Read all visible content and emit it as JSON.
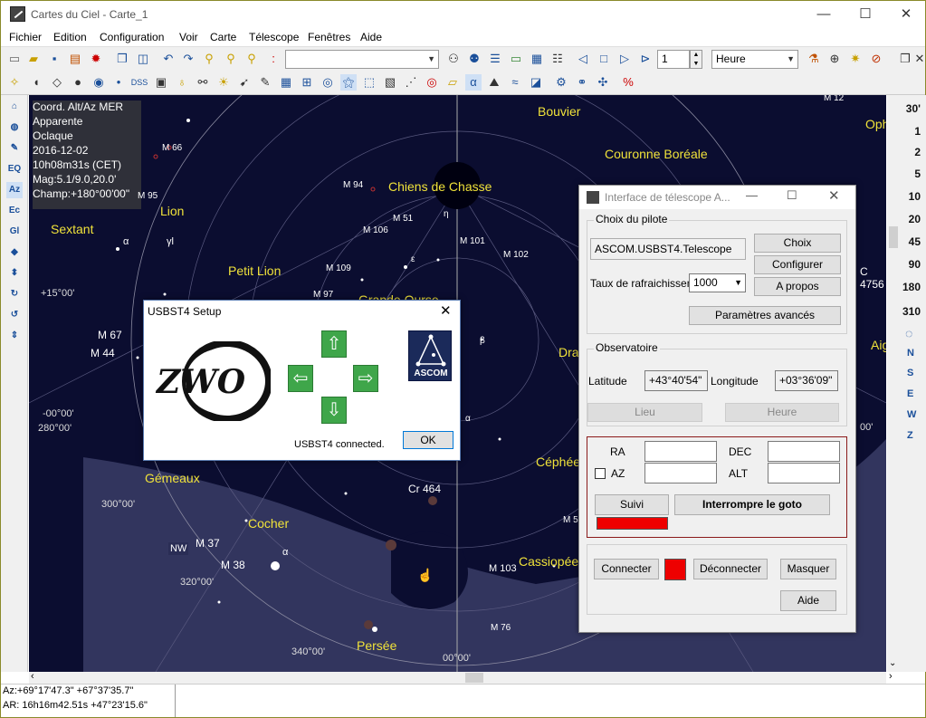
{
  "window": {
    "title": "Cartes du Ciel - Carte_1",
    "minimize": "—",
    "maximize": "☐",
    "close": "✕"
  },
  "menu": [
    "Fichier",
    "Edition",
    "Configuration",
    "Voir",
    "Carte",
    "Télescope",
    "Fenêtres",
    "Aide"
  ],
  "toolbar": {
    "page_value": "1",
    "time_unit": "Heure",
    "dss_label": "DSS"
  },
  "info_overlay": [
    "Coord. Alt/Az MER",
    "Apparente",
    "Oclaque",
    "2016-12-02",
    "10h08m31s (CET)",
    "Mag:5.1/9.0,20.0'",
    "Champ:+180°00'00\""
  ],
  "leftbar": {
    "eq": "EQ",
    "az": "Az",
    "ec": "Ec",
    "gl": "Gl"
  },
  "fov": [
    "30'",
    "1",
    "2",
    "5",
    "10",
    "20",
    "45",
    "90",
    "180",
    "310"
  ],
  "directions": [
    "N",
    "S",
    "E",
    "W",
    "Z"
  ],
  "sky": {
    "constellations": [
      "Bouvier",
      "Couronne Boréale",
      "Chiens de Chasse",
      "Sextant",
      "Lion",
      "Petit Lion",
      "Grande Ourse",
      "Dra",
      "Gémeaux",
      "Céphée",
      "Cocher",
      "Cassiopée",
      "Persée",
      "Aig",
      "Oph"
    ],
    "objects": [
      "M 12",
      "M 66",
      "M 95",
      "M 94",
      "M 51",
      "M 106",
      "M 101",
      "M 102",
      "M 109",
      "M 97",
      "M 67",
      "M 44",
      "M 37",
      "M 38",
      "M 103",
      "M 76",
      "Cr 464",
      "M 5",
      "C 4756"
    ],
    "grid_labels": [
      "+15°00'",
      "-00°00'",
      "280°00'",
      "300°00'",
      "320°00'",
      "340°00'",
      "00°00'",
      "00'"
    ],
    "greek": [
      "α",
      "γl",
      "ε",
      "η",
      "β",
      "α",
      "α"
    ],
    "nw_label": "NW"
  },
  "usbst4": {
    "title": "USBST4 Setup",
    "status": "USBST4 connected.",
    "ok": "OK",
    "logo": "ZWO",
    "ascom": "ASCOM"
  },
  "telescope": {
    "title": "Interface de télescope A...",
    "driver_legend": "Choix du pilote",
    "driver": "ASCOM.USBST4.Telescope",
    "choose": "Choix",
    "configure": "Configurer",
    "about": "A propos",
    "refresh_label": "Taux de rafraichissen",
    "refresh_value": "1000",
    "advanced": "Paramètres avancés",
    "observatory_legend": "Observatoire",
    "lat_label": "Latitude",
    "lat_value": "+43°40'54\"",
    "lon_label": "Longitude",
    "lon_value": "+03°36'09\"",
    "place": "Lieu",
    "time": "Heure",
    "ra_label": "RA",
    "dec_label": "DEC",
    "az_label": "AZ",
    "alt_label": "ALT",
    "track": "Suivi",
    "abort_goto": "Interrompre le goto",
    "connect": "Connecter",
    "disconnect": "Déconnecter",
    "hide": "Masquer",
    "help": "Aide",
    "status_color": "#ee0000"
  },
  "status": {
    "line1": "Az:+69°17'47.3\" +67°37'35.7\"",
    "line2": "AR: 16h16m42.51s +47°23'15.6\""
  }
}
